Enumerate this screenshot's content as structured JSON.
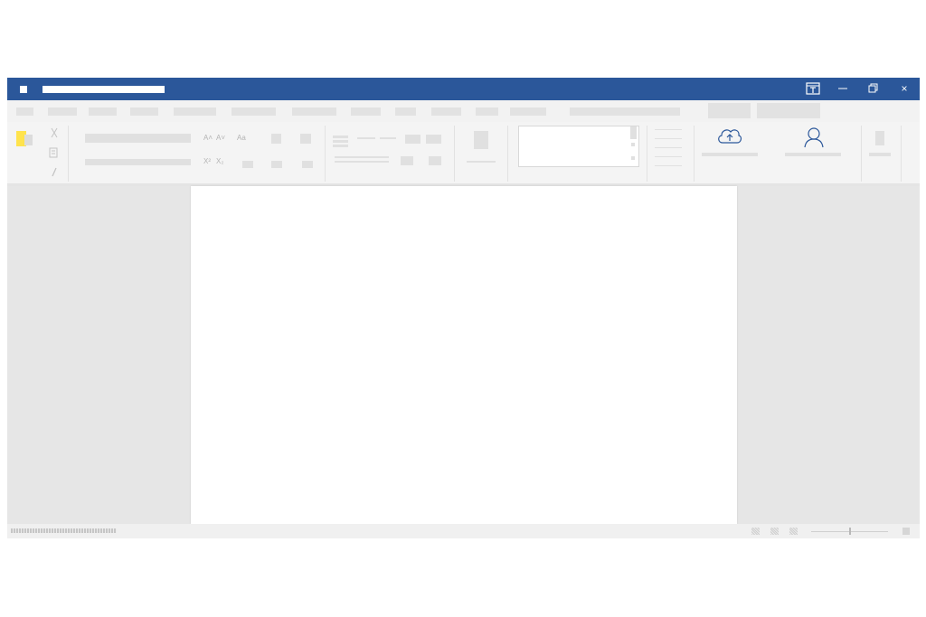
{
  "app": {
    "title": "",
    "accent": "#2b579a"
  },
  "titlebar": {
    "icons": [
      "app-icon",
      "ribbon-display-icon",
      "minimize-icon",
      "restore-icon",
      "close-icon"
    ],
    "close_glyph": "×"
  },
  "menu": {
    "items": [
      "",
      "",
      "",
      "",
      "",
      "",
      "",
      "",
      "",
      "",
      "",
      "",
      ""
    ],
    "search_placeholder": "",
    "account_labels": [
      "",
      ""
    ]
  },
  "ribbon": {
    "glyphs": {
      "grow_font": "A˄",
      "shrink_font": "A˅",
      "change_case": "Aa",
      "superscript": "X²",
      "subscript": "X₂"
    },
    "icons": [
      "paste-icon",
      "cut-icon",
      "copy-icon",
      "format-painter-icon",
      "cloud-upload-icon",
      "user-icon",
      "edit-icon"
    ],
    "cloud_label": "",
    "share_label": ""
  },
  "document": {
    "text": ""
  },
  "status": {
    "text": "",
    "zoom_level": 0.5
  }
}
